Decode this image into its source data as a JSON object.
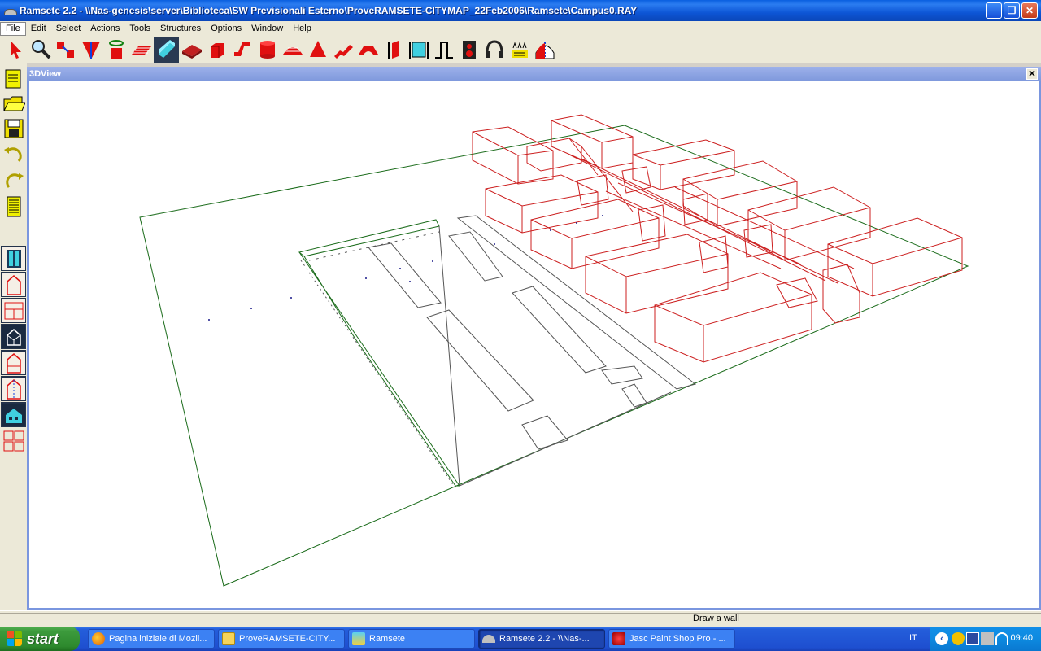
{
  "window": {
    "title": "Ramsete 2.2 - \\\\Nas-genesis\\server\\Biblioteca\\SW Previsionali Esterno\\ProveRAMSETE-CITYMAP_22Feb2006\\Ramsete\\Campus0.RAY",
    "controls": [
      "_",
      "❐",
      "✕"
    ]
  },
  "menu": [
    "File",
    "Edit",
    "Select",
    "Actions",
    "Tools",
    "Structures",
    "Options",
    "Window",
    "Help"
  ],
  "toolbar": [
    "pointer-tool-icon",
    "zoom-tool-icon",
    "select-tool-icon",
    "wall-tool-icon",
    "rotate-tool-icon",
    "plane-tool-icon",
    "box-tool-icon",
    "slab-tool-icon",
    "block-tool-icon",
    "bend-tool-icon",
    "cylinder-tool-icon",
    "dome-tool-icon",
    "cone-tool-icon",
    "ramp-tool-icon",
    "arch-tool-icon",
    "door-tool-icon",
    "window-tool-icon",
    "step-tool-icon",
    "speaker-tool-icon",
    "headphone-tool-icon",
    "people-tool-icon",
    "barrier-tool-icon"
  ],
  "sidebar": [
    "new-file-icon",
    "open-folder-icon",
    "save-icon",
    "undo-icon",
    "redo-icon",
    "notes-icon",
    "plan-view-icon",
    "front-view-icon",
    "side-view-icon",
    "3d-view-icon",
    "section-view-icon",
    "elevation-view-icon",
    "render-view-icon",
    "multi-view-icon"
  ],
  "view": {
    "title": "3DView",
    "close": "✕"
  },
  "status": {
    "message": "Draw a wall"
  },
  "taskbar": {
    "start": "start",
    "items": [
      {
        "label": "Pagina iniziale di Mozil...",
        "icon": "firefox-icon",
        "active": false
      },
      {
        "label": "ProveRAMSETE-CITY...",
        "icon": "folder-icon",
        "active": false
      },
      {
        "label": "Ramsete",
        "icon": "ramsete-icon",
        "active": false
      },
      {
        "label": "Ramsete 2.2 - \\\\Nas-...",
        "icon": "ramsete-app-icon",
        "active": true
      },
      {
        "label": "Jasc Paint Shop Pro - ...",
        "icon": "paintshop-icon",
        "active": false
      }
    ],
    "language": "IT",
    "clock": "09:40"
  },
  "colors": {
    "ground": "#1a6b1a",
    "buildings": "#cc1f1f",
    "roads": "#555555"
  }
}
